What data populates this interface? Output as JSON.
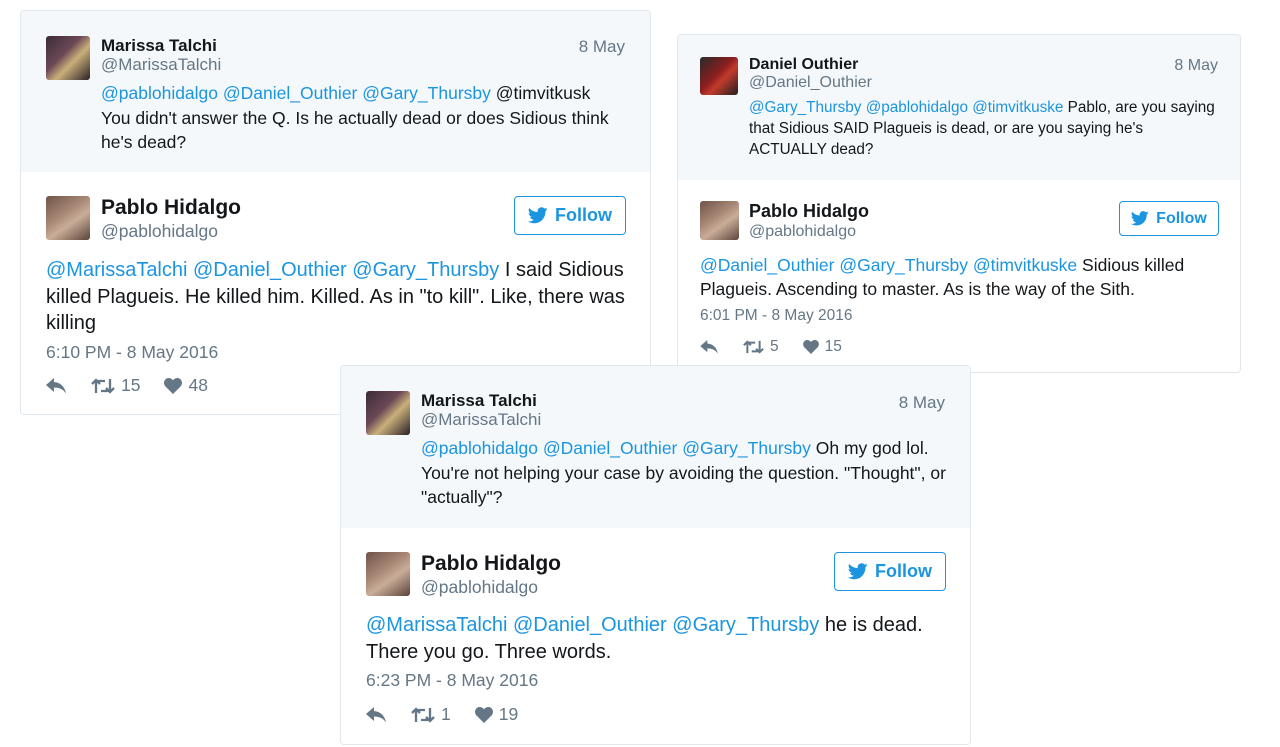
{
  "tweets": [
    {
      "quote": {
        "name": "Marissa Talchi",
        "handle": "@MarissaTalchi",
        "date": "8 May",
        "mentions": "@pablohidalgo @Daniel_Outhier @Gary_Thursby",
        "text": " @timvitkusk You didn't answer the Q. Is he actually dead or does Sidious think he's dead?"
      },
      "main": {
        "name": "Pablo Hidalgo",
        "handle": "@pablohidalgo",
        "follow_label": "Follow",
        "mentions": "@MarissaTalchi @Daniel_Outhier @Gary_Thursby",
        "text": " I said Sidious killed Plagueis. He killed him. Killed. As in \"to kill\". Like, there was killing",
        "timestamp": "6:10 PM - 8 May 2016",
        "retweets": "15",
        "likes": "48"
      }
    },
    {
      "quote": {
        "name": "Daniel Outhier",
        "handle": "@Daniel_Outhier",
        "date": "8 May",
        "mentions": "@Gary_Thursby @pablohidalgo @timvitkuske",
        "text": " Pablo, are you saying that Sidious SAID Plagueis is dead, or are you saying he's ACTUALLY dead?"
      },
      "main": {
        "name": "Pablo Hidalgo",
        "handle": "@pablohidalgo",
        "follow_label": "Follow",
        "mentions": "@Daniel_Outhier @Gary_Thursby @timvitkuske",
        "text": " Sidious killed Plagueis. Ascending to master. As is the way of the Sith.",
        "timestamp": "6:01 PM - 8 May 2016",
        "retweets": "5",
        "likes": "15"
      }
    },
    {
      "quote": {
        "name": "Marissa Talchi",
        "handle": "@MarissaTalchi",
        "date": "8 May",
        "mentions": "@pablohidalgo @Daniel_Outhier @Gary_Thursby",
        "text": " Oh my god lol. You're not helping your case by avoiding the question. \"Thought\", or \"actually\"?"
      },
      "main": {
        "name": "Pablo Hidalgo",
        "handle": "@pablohidalgo",
        "follow_label": "Follow",
        "mentions": "@MarissaTalchi @Daniel_Outhier @Gary_Thursby",
        "text": " he is dead. There you go. Three words.",
        "timestamp": "6:23 PM - 8 May 2016",
        "retweets": "1",
        "likes": "19"
      }
    }
  ],
  "icons": {
    "follow": "twitter-bird-icon",
    "reply": "reply-icon",
    "retweet": "retweet-icon",
    "like": "heart-icon"
  },
  "colors": {
    "link": "#1b95e0",
    "muted": "#657786",
    "quote_bg": "#f5f8fa",
    "border": "#e1e8ed"
  }
}
